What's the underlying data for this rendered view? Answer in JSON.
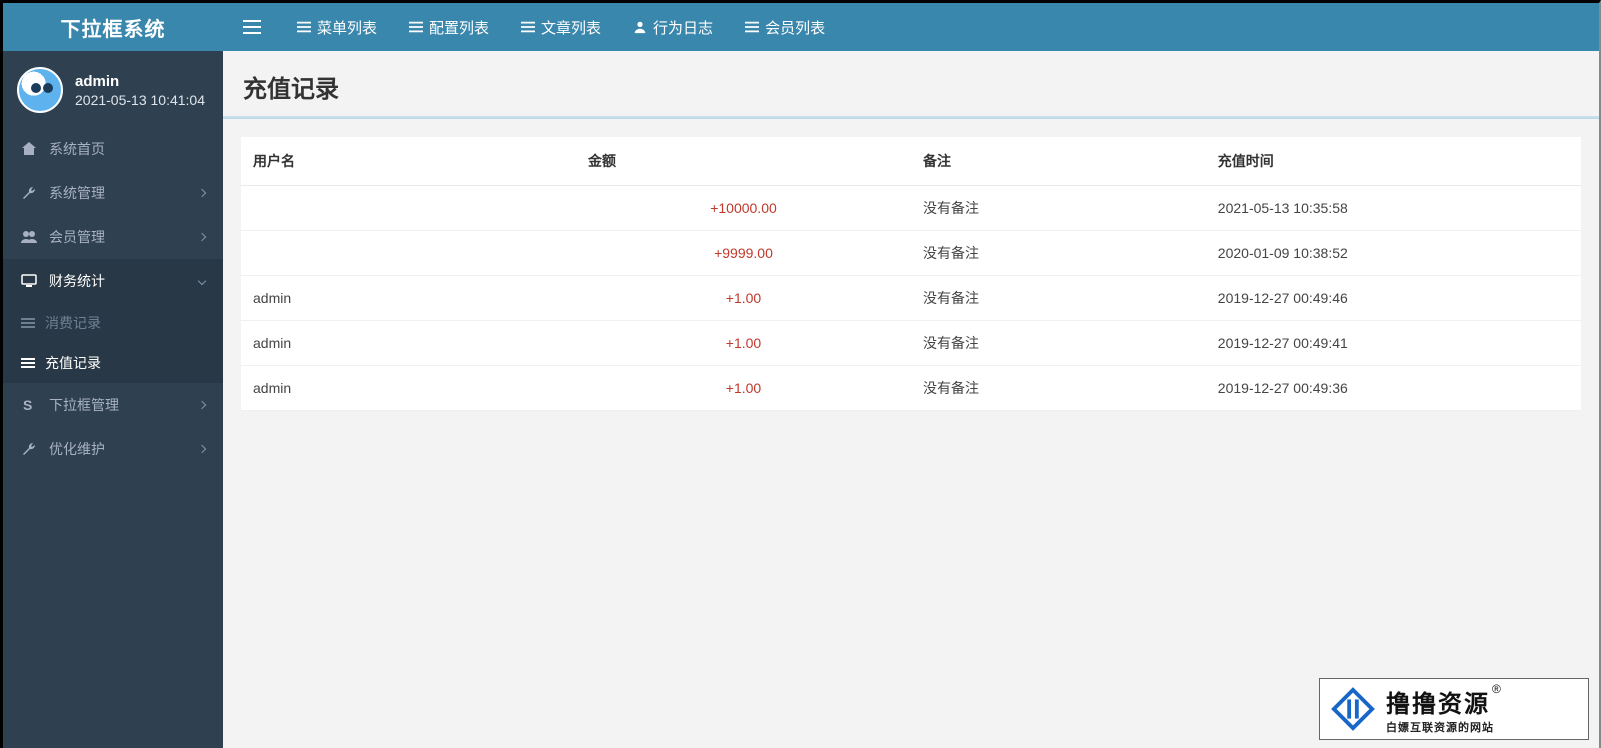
{
  "brand": "下拉框系统",
  "topnav": [
    {
      "label": "菜单列表",
      "icon": "list"
    },
    {
      "label": "配置列表",
      "icon": "list"
    },
    {
      "label": "文章列表",
      "icon": "list"
    },
    {
      "label": "行为日志",
      "icon": "user"
    },
    {
      "label": "会员列表",
      "icon": "list"
    }
  ],
  "user": {
    "name": "admin",
    "time": "2021-05-13 10:41:04"
  },
  "sidebar": [
    {
      "label": "系统首页",
      "icon": "home",
      "expandable": false
    },
    {
      "label": "系统管理",
      "icon": "wrench",
      "expandable": true
    },
    {
      "label": "会员管理",
      "icon": "users",
      "expandable": true
    },
    {
      "label": "财务统计",
      "icon": "monitor",
      "expandable": true,
      "open": true,
      "children": [
        {
          "label": "消费记录",
          "active": false
        },
        {
          "label": "充值记录",
          "active": true
        }
      ]
    },
    {
      "label": "下拉框管理",
      "icon": "s",
      "expandable": true
    },
    {
      "label": "优化维护",
      "icon": "wrench",
      "expandable": true
    }
  ],
  "page": {
    "title": "充值记录"
  },
  "table": {
    "columns": [
      "用户名",
      "金额",
      "备注",
      "充值时间"
    ],
    "rows": [
      {
        "user": "",
        "amount": "+10000.00",
        "remark": "没有备注",
        "time": "2021-05-13 10:35:58"
      },
      {
        "user": "",
        "amount": "+9999.00",
        "remark": "没有备注",
        "time": "2020-01-09 10:38:52"
      },
      {
        "user": "admin",
        "amount": "+1.00",
        "remark": "没有备注",
        "time": "2019-12-27 00:49:46"
      },
      {
        "user": "admin",
        "amount": "+1.00",
        "remark": "没有备注",
        "time": "2019-12-27 00:49:41"
      },
      {
        "user": "admin",
        "amount": "+1.00",
        "remark": "没有备注",
        "time": "2019-12-27 00:49:36"
      }
    ]
  },
  "watermark": {
    "big": "撸撸资源",
    "reg": "®",
    "small": "白嫖互联资源的网站"
  }
}
